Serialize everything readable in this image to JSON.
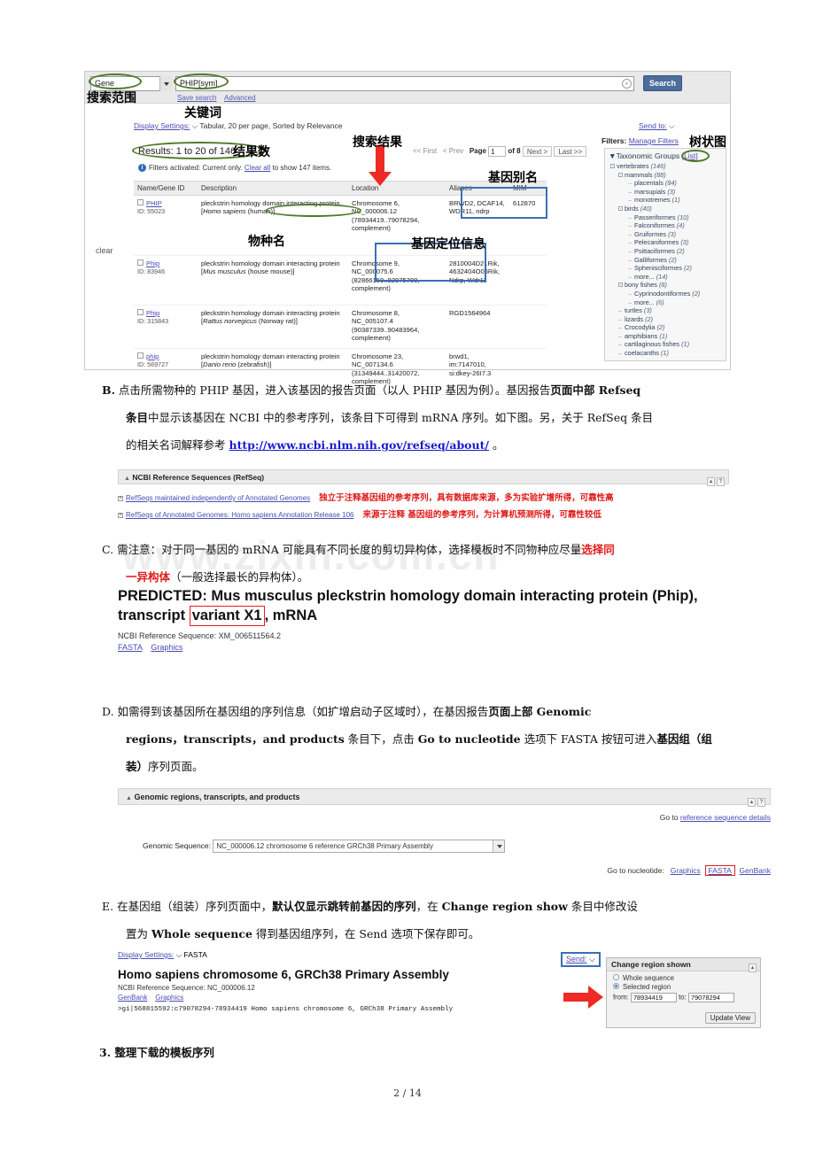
{
  "annotations": {
    "search_scope": "搜索范围",
    "keyword": "关键词",
    "result_count": "结果数",
    "search_results": "搜索结果",
    "gene_alias": "基因别名",
    "species_name": "物种名",
    "gene_location_info": "基因定位信息",
    "tree_diagram": "树状图",
    "clear": "clear"
  },
  "ncbi_search": {
    "database": "Gene",
    "query": "PHIP[sym]",
    "search_button": "Search",
    "save_search": "Save search",
    "advanced": "Advanced",
    "clear_icon": "×",
    "display_settings_label": "Display Settings:",
    "display_settings_value": "Tabular, 20 per page, Sorted by Relevance",
    "send_to": "Send to:",
    "results_text": "Results: 1 to 20 of 146",
    "filters_note_prefix": "Filters activated: Current only.",
    "filters_note_link": "Clear all",
    "filters_note_suffix": "to show 147 items.",
    "pager": {
      "first": "<< First",
      "prev": "< Prev",
      "page_label": "Page",
      "page_value": "1",
      "of": "of 8",
      "next": "Next >",
      "last": "Last >>"
    },
    "filters_label": "Filters:",
    "manage_filters": "Manage Filters",
    "table": {
      "headers": [
        "Name/Gene ID",
        "Description",
        "Location",
        "Aliases",
        "MIM"
      ],
      "rows": [
        {
          "name": "PHIP",
          "gene_id": "ID: 55023",
          "description_pre": "pleckstrin homology domain interacting protein [",
          "description_species": "Homo sapiens",
          "description_post": " (human)]",
          "location": "Chromosome 6, NC_000006.12 (78934419..79078294, complement)",
          "aliases": "BRWD2, DCAF14, WDR11, ndrp",
          "mim": "612870"
        },
        {
          "name": "Phip",
          "gene_id": "ID: 83946",
          "description_pre": "pleckstrin homology domain interacting protein [",
          "description_species": "Mus musculus",
          "description_post": " (house mouse)]",
          "location": "Chromosome 9, NC_000075.6 (82866159..82975700, complement)",
          "aliases": "2810004D21Rik, 4632404O06Rik, Ndrp, Wdr11",
          "mim": ""
        },
        {
          "name": "Phip",
          "gene_id": "ID: 315843",
          "description_pre": "pleckstrin homology domain interacting protein [",
          "description_species": "Rattus norvegicus",
          "description_post": " (Norway rat)]",
          "location": "Chromosome 8, NC_005107.4 (90387339..90483964, complement)",
          "aliases": "RGD1564964",
          "mim": ""
        },
        {
          "name": "phip",
          "gene_id": "ID: 569727",
          "description_pre": "pleckstrin homology domain interacting protein [",
          "description_species": "Danio rerio",
          "description_post": " (zebrafish)]",
          "location": "Chromosome 23, NC_007134.6 (31349444..31420072, complement)",
          "aliases": "brwd1, im:7147010, si:dkey-26I7.3",
          "mim": ""
        }
      ]
    },
    "taxonomic_groups": {
      "title": "Taxonomic Groups",
      "list_link": "[List]",
      "items": [
        {
          "label": "vertebrates",
          "count": "(146)",
          "level": 0,
          "marker": "box"
        },
        {
          "label": "mammals",
          "count": "(88)",
          "level": 1,
          "marker": "box"
        },
        {
          "label": "placentals",
          "count": "(84)",
          "level": 2,
          "marker": "dash"
        },
        {
          "label": "marsupials",
          "count": "(3)",
          "level": 2,
          "marker": "dash"
        },
        {
          "label": "monotremes",
          "count": "(1)",
          "level": 2,
          "marker": "dash"
        },
        {
          "label": "birds",
          "count": "(40)",
          "level": 1,
          "marker": "box"
        },
        {
          "label": "Passeriformes",
          "count": "(10)",
          "level": 2,
          "marker": "dash"
        },
        {
          "label": "Falconiformes",
          "count": "(4)",
          "level": 2,
          "marker": "dash"
        },
        {
          "label": "Gruiformes",
          "count": "(3)",
          "level": 2,
          "marker": "dash"
        },
        {
          "label": "Pelecaniformes",
          "count": "(3)",
          "level": 2,
          "marker": "dash"
        },
        {
          "label": "Psittaciformes",
          "count": "(2)",
          "level": 2,
          "marker": "dash"
        },
        {
          "label": "Galliformes",
          "count": "(2)",
          "level": 2,
          "marker": "dash"
        },
        {
          "label": "Sphenisciformes",
          "count": "(2)",
          "level": 2,
          "marker": "dash"
        },
        {
          "label": "more...",
          "count": "(14)",
          "level": 2,
          "marker": "dash"
        },
        {
          "label": "bony fishes",
          "count": "(8)",
          "level": 1,
          "marker": "box"
        },
        {
          "label": "Cyprinodontiformes",
          "count": "(2)",
          "level": 2,
          "marker": "dash"
        },
        {
          "label": "more...",
          "count": "(6)",
          "level": 2,
          "marker": "dash"
        },
        {
          "label": "turtles",
          "count": "(3)",
          "level": 1,
          "marker": "dash"
        },
        {
          "label": "lizards",
          "count": "(2)",
          "level": 1,
          "marker": "dash"
        },
        {
          "label": "Crocodylia",
          "count": "(2)",
          "level": 1,
          "marker": "dash"
        },
        {
          "label": "amphibians",
          "count": "(1)",
          "level": 1,
          "marker": "dash"
        },
        {
          "label": "cartilaginous fishes",
          "count": "(1)",
          "level": 1,
          "marker": "dash"
        },
        {
          "label": "coelacanths",
          "count": "(1)",
          "level": 1,
          "marker": "dash"
        }
      ]
    }
  },
  "para_b": {
    "marker": "B.",
    "line1_a": "点击所需物种的 PHIP 基因，进入该基因的报告页面（以人 PHIP 基因为例）。基因报告",
    "line1_b": "页面中部 Refseq",
    "line2_a": "条目",
    "line2_b": "中显示该基因在 NCBI 中的参考序列，该条目下可得到 mRNA 序列。如下图。另，关于 RefSeq 条目",
    "line3_a": "的相关名词解释参考",
    "line3_link": "http://www.ncbi.nlm.nih.gov/refseq/about/",
    "line3_b": "。"
  },
  "refseq_panel": {
    "title": "NCBI Reference Sequences (RefSeq)",
    "rows": [
      {
        "link": "RefSeqs maintained independently of Annotated Genomes",
        "note": "独立于注释基因组的参考序列，具有数据库来源，多为实验扩增所得，可靠性高"
      },
      {
        "link": "RefSeqs of Annotated Genomes: Homo sapiens Annotation Release 106",
        "note": "来源于注释 基因组的参考序列，为计算机预测所得，可靠性较低"
      }
    ]
  },
  "para_c": {
    "marker": "C.",
    "line1_a": "需注意：对于同一基因的 mRNA 可能具有不同长度的剪切异构体，选择模板时不同物种应尽量",
    "line1_red": "选择同",
    "line2_red": "一异构体",
    "line2_b": "（一般选择最长的异构体）。"
  },
  "predicted": {
    "title_a": "PREDICTED: Mus musculus pleckstrin homology domain interacting protein (Phip),",
    "title_b": "transcript ",
    "title_highlight": "variant X1",
    "title_c": ", mRNA",
    "accession": "NCBI Reference Sequence: XM_006511564.2",
    "link_fasta": "FASTA",
    "link_graphics": "Graphics"
  },
  "para_d": {
    "marker": "D.",
    "line1_a": "如需得到该基因所在基因组的序列信息（如扩增启动子区域时），在基因报告",
    "line1_b": "页面上部 Genomic",
    "line2_a": "regions，transcripts，and products",
    "line2_b": " 条目下，点击 ",
    "line2_c": "Go to nucleotide",
    "line2_d": " 选项下 FASTA 按钮可进入",
    "line2_e": "基因组（组",
    "line3_a": "装）",
    "line3_b": "序列页面。"
  },
  "genomic_panel": {
    "title": "Genomic regions, transcripts, and products",
    "goto_ref_prefix": "Go to ",
    "goto_ref_link": "reference sequence details",
    "genomic_sequence_label": "Genomic Sequence:",
    "genomic_sequence_value": "NC_000006.12 chromosome 6 reference GRCh38 Primary Assembly",
    "goto_nucleotide_label": "Go to nucleotide:",
    "nuc_graphics": "Graphics",
    "nuc_fasta": "FASTA",
    "nuc_genbank": "GenBank"
  },
  "para_e": {
    "marker": "E.",
    "line1_a": "在基因组（组装）序列页面中，",
    "line1_b": "默认仅显示跳转前基因的序列",
    "line1_c": "，在 ",
    "line1_d": "Change region show",
    "line1_e": " 条目中修改设",
    "line2_a": "置为 ",
    "line2_b": "Whole sequence",
    "line2_c": " 得到基因组序列，在 Send 选项下保存即可。"
  },
  "fasta_page": {
    "display_settings_label": "Display Settings:",
    "display_settings_value": "FASTA",
    "title": "Homo sapiens chromosome 6, GRCh38 Primary Assembly",
    "accession": "NCBI Reference Sequence: NC_000006.12",
    "link_genbank": "GenBank",
    "link_graphics": "Graphics",
    "sequence_header": ">gi|568815592:c79078294-78934419 Homo sapiens chromosome 6, GRCh38 Primary Assembly",
    "send_label": "Send:"
  },
  "change_region": {
    "title": "Change region shown",
    "option_whole": "Whole sequence",
    "option_selected": "Selected region",
    "from_label": "from:",
    "from_value": "78934419",
    "to_label": "to:",
    "to_value": "79078294",
    "update_button": "Update View"
  },
  "section3": {
    "marker": "3.",
    "title": "整理下载的模板序列"
  },
  "footer": {
    "page": "2  / 14"
  },
  "watermark": {
    "text": "www.zixin.com.cn"
  },
  "colors": {
    "accent_blue": "#4c6d9c",
    "link": "#4a4ab5",
    "annotation_red": "#e01b1b",
    "annotation_green": "#4f7a2a",
    "annotation_blue": "#3a6fb5"
  }
}
